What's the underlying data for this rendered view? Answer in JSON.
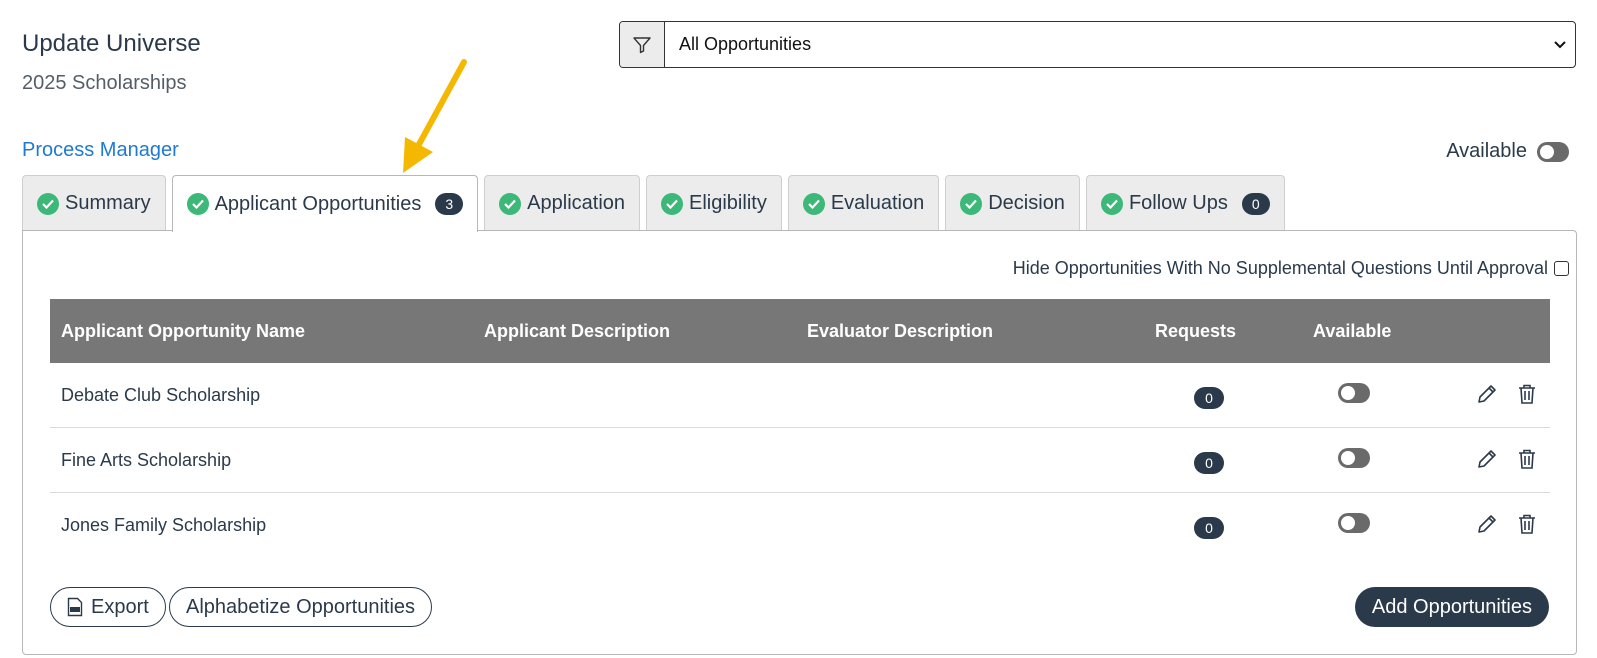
{
  "header": {
    "title": "Update Universe",
    "subtitle": "2025 Scholarships",
    "process_link": "Process Manager"
  },
  "filter": {
    "selected": "All Opportunities",
    "icon": "filter-icon"
  },
  "availability": {
    "label": "Available"
  },
  "tabs": [
    {
      "label": "Summary",
      "badge": null
    },
    {
      "label": "Applicant Opportunities",
      "badge": "3"
    },
    {
      "label": "Application",
      "badge": null
    },
    {
      "label": "Eligibility",
      "badge": null
    },
    {
      "label": "Evaluation",
      "badge": null
    },
    {
      "label": "Decision",
      "badge": null
    },
    {
      "label": "Follow Ups",
      "badge": "0"
    }
  ],
  "options": {
    "hide_label": "Hide Opportunities With No Supplemental Questions Until Approval"
  },
  "table": {
    "columns": [
      "Applicant Opportunity Name",
      "Applicant Description",
      "Evaluator Description",
      "Requests",
      "Available"
    ],
    "rows": [
      {
        "name": "Debate Club Scholarship",
        "requests": "0"
      },
      {
        "name": "Fine Arts Scholarship",
        "requests": "0"
      },
      {
        "name": "Jones Family Scholarship",
        "requests": "0"
      }
    ]
  },
  "actions": {
    "export": "Export",
    "alphabetize": "Alphabetize Opportunities",
    "add": "Add Opportunities"
  },
  "colors": {
    "accent_link": "#1f7ad1",
    "check_green": "#3cb878",
    "dark": "#2b3a4a",
    "header_gray": "#777777",
    "annotation_arrow": "#f5b800"
  }
}
